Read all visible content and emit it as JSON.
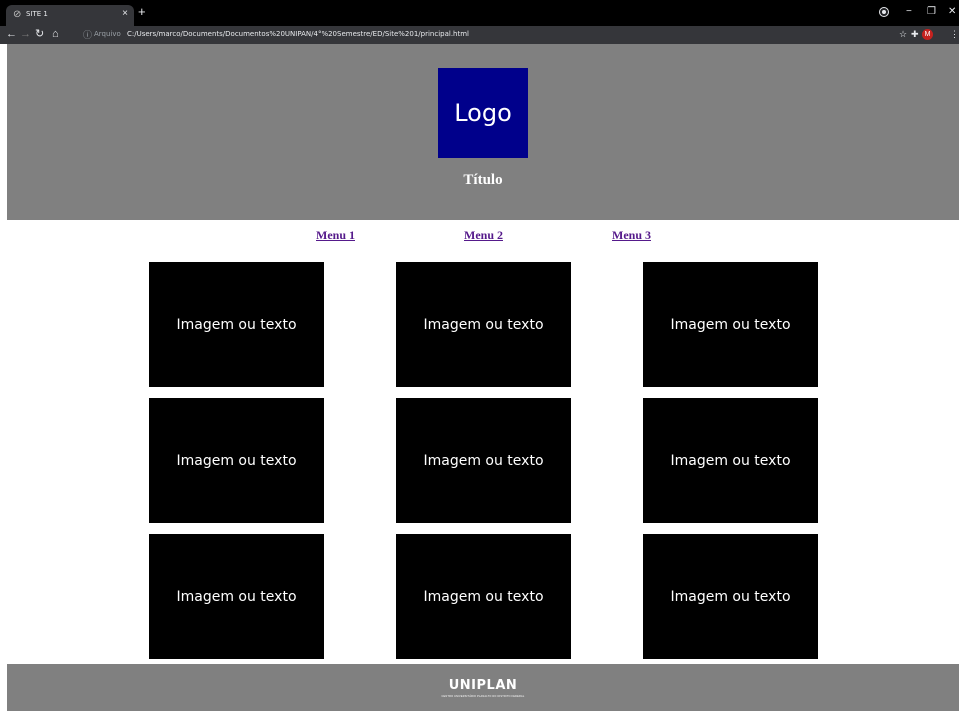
{
  "browser": {
    "tab_title": "SITE 1",
    "tab_close": "×",
    "new_tab": "+",
    "scheme_label": "Arquivo",
    "url": "C:/Users/marco/Documents/Documentos%20UNIPAN/4°%20Semestre/ED/Site%201/principal.html",
    "profile_initial": "M",
    "icons": {
      "back": "back-icon",
      "forward": "forward-icon",
      "reload": "reload-icon",
      "home": "home-icon",
      "info": "info-icon",
      "bookmark": "star-icon",
      "extensions": "puzzle-icon",
      "menu": "kebab-menu-icon"
    }
  },
  "header": {
    "logo_text": "Logo",
    "title": "Título",
    "background": "#808080",
    "logo_color": "#00008b"
  },
  "nav": {
    "items": [
      {
        "label": "Menu 1"
      },
      {
        "label": "Menu 2"
      },
      {
        "label": "Menu 3"
      }
    ],
    "link_color": "#551a8b"
  },
  "grid": {
    "cards": [
      {
        "text": "Imagem ou texto"
      },
      {
        "text": "Imagem ou texto"
      },
      {
        "text": "Imagem ou texto"
      },
      {
        "text": "Imagem ou texto"
      },
      {
        "text": "Imagem ou texto"
      },
      {
        "text": "Imagem ou texto"
      },
      {
        "text": "Imagem ou texto"
      },
      {
        "text": "Imagem ou texto"
      },
      {
        "text": "Imagem ou texto"
      }
    ]
  },
  "footer": {
    "brand": "UNIPLAN",
    "tagline": "CENTRO UNIVERSITÁRIO PLANALTO DO DISTRITO FEDERAL"
  }
}
